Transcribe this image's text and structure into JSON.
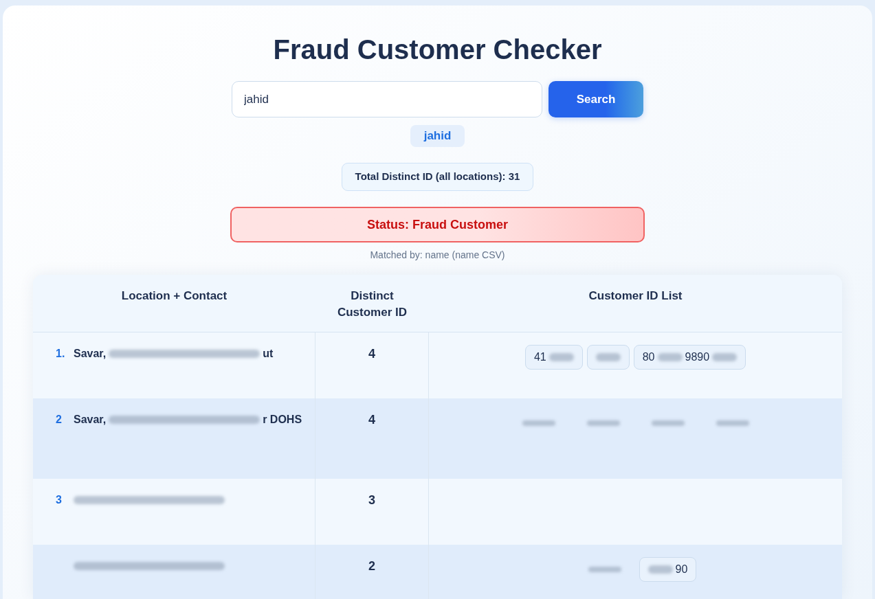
{
  "page": {
    "title": "Fraud Customer Checker"
  },
  "search": {
    "value": "jahid",
    "button": "Search"
  },
  "query_tag": "jahid",
  "total": "Total Distinct ID (all locations): 31",
  "status": {
    "kind": "fraud",
    "text": "Status: Fraud Customer"
  },
  "matched_by": "Matched by: name (name CSV)",
  "table": {
    "columns": [
      "Location + Contact",
      "Distinct Customer ID",
      "Customer ID List"
    ],
    "rows": [
      {
        "number": "1.",
        "location": [
          {
            "kind": "text",
            "text": "Savar,"
          },
          {
            "kind": "blur"
          },
          {
            "kind": "text",
            "text": "ut"
          }
        ],
        "distinct": "4",
        "ids": [
          {
            "kind": "chip",
            "parts": [
              {
                "kind": "text",
                "text": "41"
              },
              {
                "kind": "blur"
              }
            ]
          },
          {
            "kind": "chip",
            "parts": [
              {
                "kind": "blur"
              }
            ]
          },
          {
            "kind": "chip",
            "parts": [
              {
                "kind": "text",
                "text": "80"
              },
              {
                "kind": "blur"
              },
              {
                "kind": "text",
                "text": "9890"
              },
              {
                "kind": "blur"
              }
            ]
          }
        ]
      },
      {
        "number": "2",
        "location": [
          {
            "kind": "text",
            "text": "Savar,"
          },
          {
            "kind": "blur"
          },
          {
            "kind": "text",
            "text": "r DOHS"
          }
        ],
        "distinct": "4",
        "ids": [
          {
            "kind": "blur"
          },
          {
            "kind": "blur"
          },
          {
            "kind": "blur"
          },
          {
            "kind": "blur"
          }
        ]
      },
      {
        "number": "3",
        "location": [
          {
            "kind": "blur"
          }
        ],
        "distinct": "3"
      },
      {
        "location": [
          {
            "kind": "blur"
          }
        ],
        "distinct": "2",
        "ids": [
          {
            "kind": "blur"
          },
          {
            "kind": "chip",
            "parts": [
              {
                "kind": "blur"
              },
              {
                "kind": "text",
                "text": "90"
              }
            ]
          }
        ]
      }
    ]
  }
}
